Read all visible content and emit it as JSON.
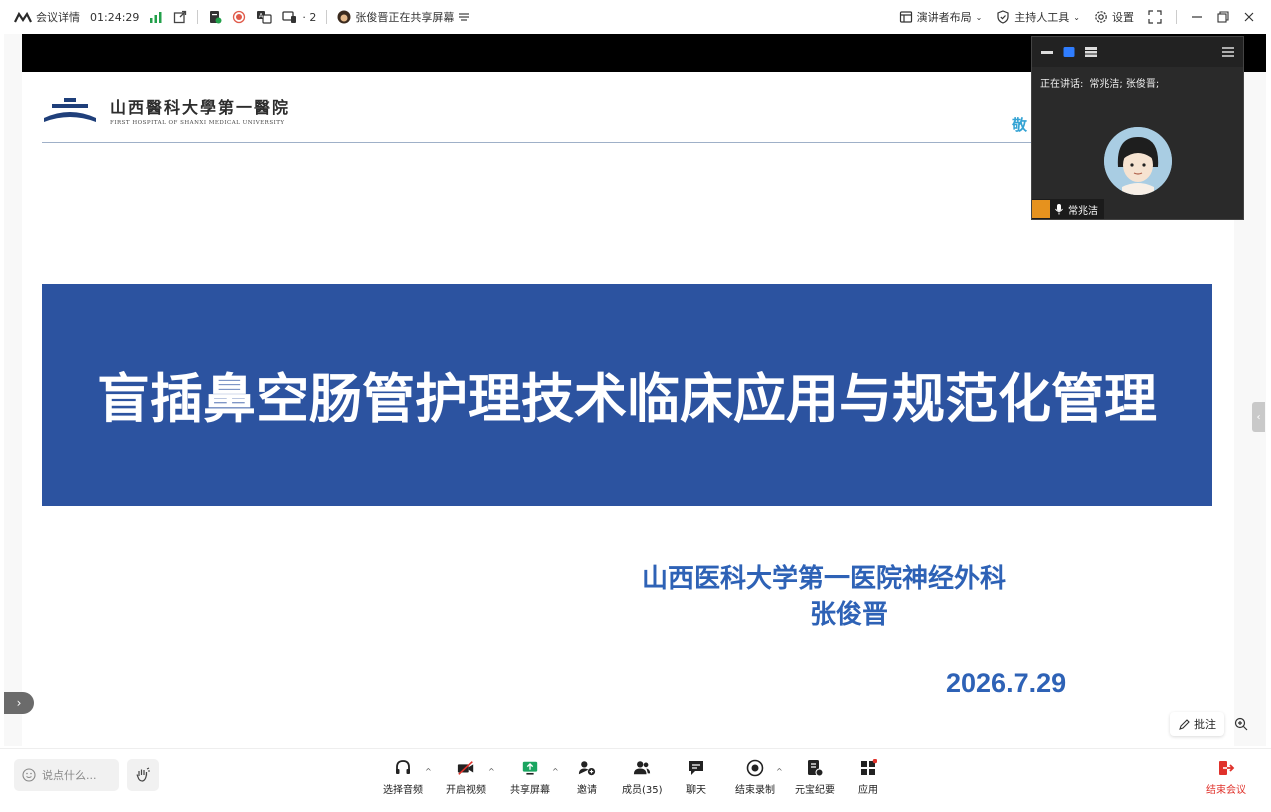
{
  "topbar": {
    "meeting_details": "会议详情",
    "timer": "01:24:29",
    "participants_count": "2",
    "sharing_status": "张俊晋正在共享屏幕",
    "presenter_layout": "演讲者布局",
    "host_tools": "主持人工具",
    "settings": "设置"
  },
  "slide": {
    "logo_cn": "山西醫科大學第一醫院",
    "logo_en": "FIRST HOSPITAL OF SHANXI MEDICAL UNIVERSITY",
    "cut_text": "敬",
    "title": "盲插鼻空肠管护理技术临床应用与规范化管理",
    "org": "山西医科大学第一医院神经外科",
    "author": "张俊晋",
    "date": "2026.7.29"
  },
  "speaker_panel": {
    "talking_label": "正在讲话:",
    "talking_names": "常兆洁; 张俊晋;",
    "name": "常兆洁"
  },
  "annotate": {
    "label": "批注"
  },
  "bottombar": {
    "chat_placeholder": "说点什么...",
    "tools": {
      "audio": "选择音频",
      "video": "开启视频",
      "share": "共享屏幕",
      "invite": "邀请",
      "members": "成员(35)",
      "chat": "聊天",
      "record": "结束录制",
      "ai_minutes": "元宝纪要",
      "apps": "应用"
    },
    "end_meeting": "结束会议"
  },
  "colors": {
    "title_band": "#2c53a0",
    "slide_text_blue": "#2e62b6",
    "end_red": "#e0322b",
    "signal_green": "#22a04a"
  }
}
